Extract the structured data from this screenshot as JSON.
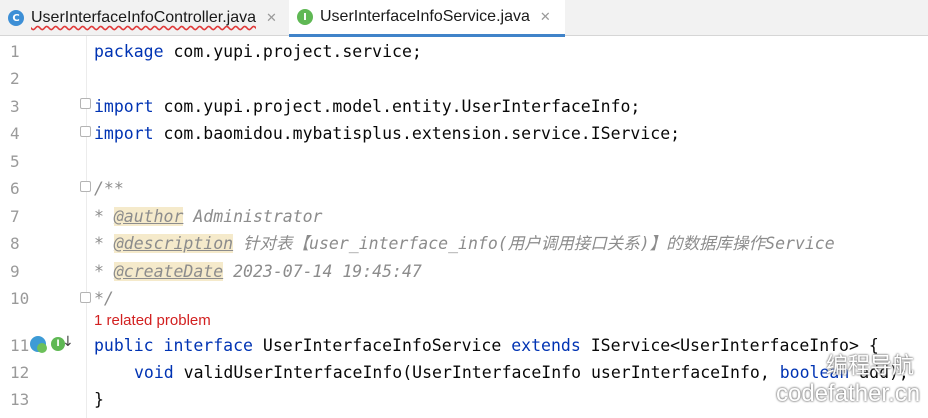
{
  "tabs": [
    {
      "label": "UserInterfaceInfoController.java",
      "icon": "C",
      "close": "✕"
    },
    {
      "label": "UserInterfaceInfoService.java",
      "icon": "I",
      "close": "✕"
    }
  ],
  "line_numbers": [
    "1",
    "2",
    "3",
    "4",
    "5",
    "6",
    "7",
    "8",
    "9",
    "10",
    "11",
    "12",
    "13"
  ],
  "code": {
    "l1_kw": "package",
    "l1_rest": " com.yupi.project.service;",
    "l3_kw": "import",
    "l3_rest": " com.yupi.project.model.entity.UserInterfaceInfo;",
    "l4_kw": "import",
    "l4_rest": " com.baomidou.mybatisplus.extension.service.IService;",
    "l6": "/**",
    "l7_star": "* ",
    "l7_tag": "@author",
    "l7_rest": " Administrator",
    "l8_star": "* ",
    "l8_tag": "@description",
    "l8_rest": " 针对表【user_interface_info(用户调用接口关系)】的数据库操作Service",
    "l9_star": "* ",
    "l9_tag": "@createDate",
    "l9_rest": " 2023-07-14 19:45:47",
    "l10": "*/",
    "problem": "1 related problem",
    "l11_kw1": "public",
    "l11_kw2": "interface",
    "l11_name": " UserInterfaceInfoService ",
    "l11_kw3": "extends",
    "l11_rest": " IService<UserInterfaceInfo> {",
    "l12_kw1": "void",
    "l12_mid": " validUserInterfaceInfo(UserInterfaceInfo userInterfaceInfo, ",
    "l12_kw2": "boolean",
    "l12_rest": " add);",
    "l13": "}"
  },
  "watermark": {
    "line1": "编程导航",
    "line2": "codefather.cn"
  }
}
